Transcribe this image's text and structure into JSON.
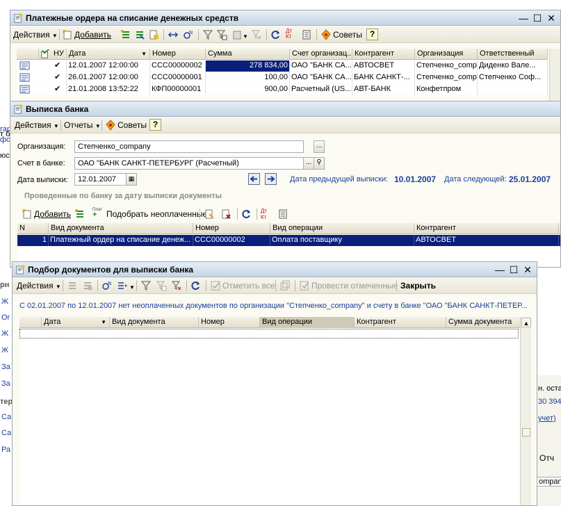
{
  "colors": {
    "selection": "#0a1f7a",
    "selection_text": "#ffffff",
    "link": "#1a3f9c",
    "title_gradient_top": "#e6eef7",
    "title_gradient_bottom": "#c7d5e4"
  },
  "w1": {
    "title": "Платежные ордера на списание денежных средств",
    "actions": "Действия",
    "add": "Добавить",
    "tips": "Советы",
    "help": "?",
    "columns": [
      "НУ",
      "Дата",
      "Номер",
      "Сумма",
      "Счет организац...",
      "Контрагент",
      "Организация",
      "Ответственный"
    ],
    "rows": [
      {
        "date": "12.01.2007 12:00:00",
        "number": "ССС00000002",
        "sum": "278 834,00",
        "account": "ОАО \"БАНК СА...",
        "contractor": "АВТОСВЕТ",
        "org": "Степченко_compa...",
        "resp": "Диденко Вале..."
      },
      {
        "date": "26.01.2007 12:00:00",
        "number": "ССС00000001",
        "sum": "100,00",
        "account": "ОАО \"БАНК СА...",
        "contractor": "БАНК САНКТ-...",
        "org": "Степченко_compa...",
        "resp": "Степченко Соф..."
      },
      {
        "date": "21.01.2008 13:52:22",
        "number": "КФП00000001",
        "sum": "900,00",
        "account": "Расчетный (US...",
        "contractor": "АВТ-БАНК",
        "org": "Конфетпром",
        "resp": ""
      }
    ]
  },
  "w2": {
    "title": "Выписка банка",
    "actions": "Действия",
    "reports": "Отчеты",
    "tips": "Советы",
    "help": "?",
    "org_label": "Организация:",
    "org_value": "Степченко_company",
    "bank_label": "Счет в банке:",
    "bank_value": "ОАО \"БАНК САНКТ-ПЕТЕРБУРГ (Расчетный)",
    "date_label": "Дата выписки:",
    "date_value": "12.01.2007",
    "prev_label": "Дата предыдущей выписки:",
    "prev_value": "10.01.2007",
    "next_label": "Дата следующей:",
    "next_value": "25.01.2007",
    "section": "Проведенные по банку за дату выписки документы",
    "add": "Добавить",
    "pick_unpaid": "Подобрать неоплаченные",
    "pick_icon_text": "Плат",
    "dt_kt": "Дт Кт",
    "columns": [
      "N",
      "Вид документа",
      "Номер",
      "Вид операции",
      "Контрагент"
    ],
    "row": {
      "n": "1",
      "doc": "Платежный ордер на списание денеж...",
      "number": "ССС00000002",
      "op": "Оплата поставщику",
      "contractor": "АВТОСВЕТ"
    }
  },
  "w3": {
    "title": "Подбор документов для выписки банка",
    "actions": "Действия",
    "mark_all": "Отметить все",
    "post_marked": "Провести отмеченные",
    "close": "Закрыть",
    "message": "С 02.01.2007 по 12.01.2007 нет неоплаченных документов по организации \"Степченко_company\" и счету в банке \"ОАО \"БАНК САНКТ-ПЕТЕР...",
    "columns": [
      "Дата",
      "Вид документа",
      "Номер",
      "Вид операции",
      "Контрагент",
      "Сумма документа"
    ]
  },
  "bg": {
    "left_fragments": [
      "гар",
      "т б",
      "фс",
      "юс",
      "рн",
      "Ж",
      "Ог",
      "Ж",
      "Ж",
      "За",
      "За",
      "тер",
      "Са",
      "Са",
      "Ра"
    ],
    "right_fragments": [
      "н. оста",
      "30 394",
      "учет)",
      "Отч",
      "ompany"
    ],
    "dt_kt_w1": "Дт Кт"
  }
}
